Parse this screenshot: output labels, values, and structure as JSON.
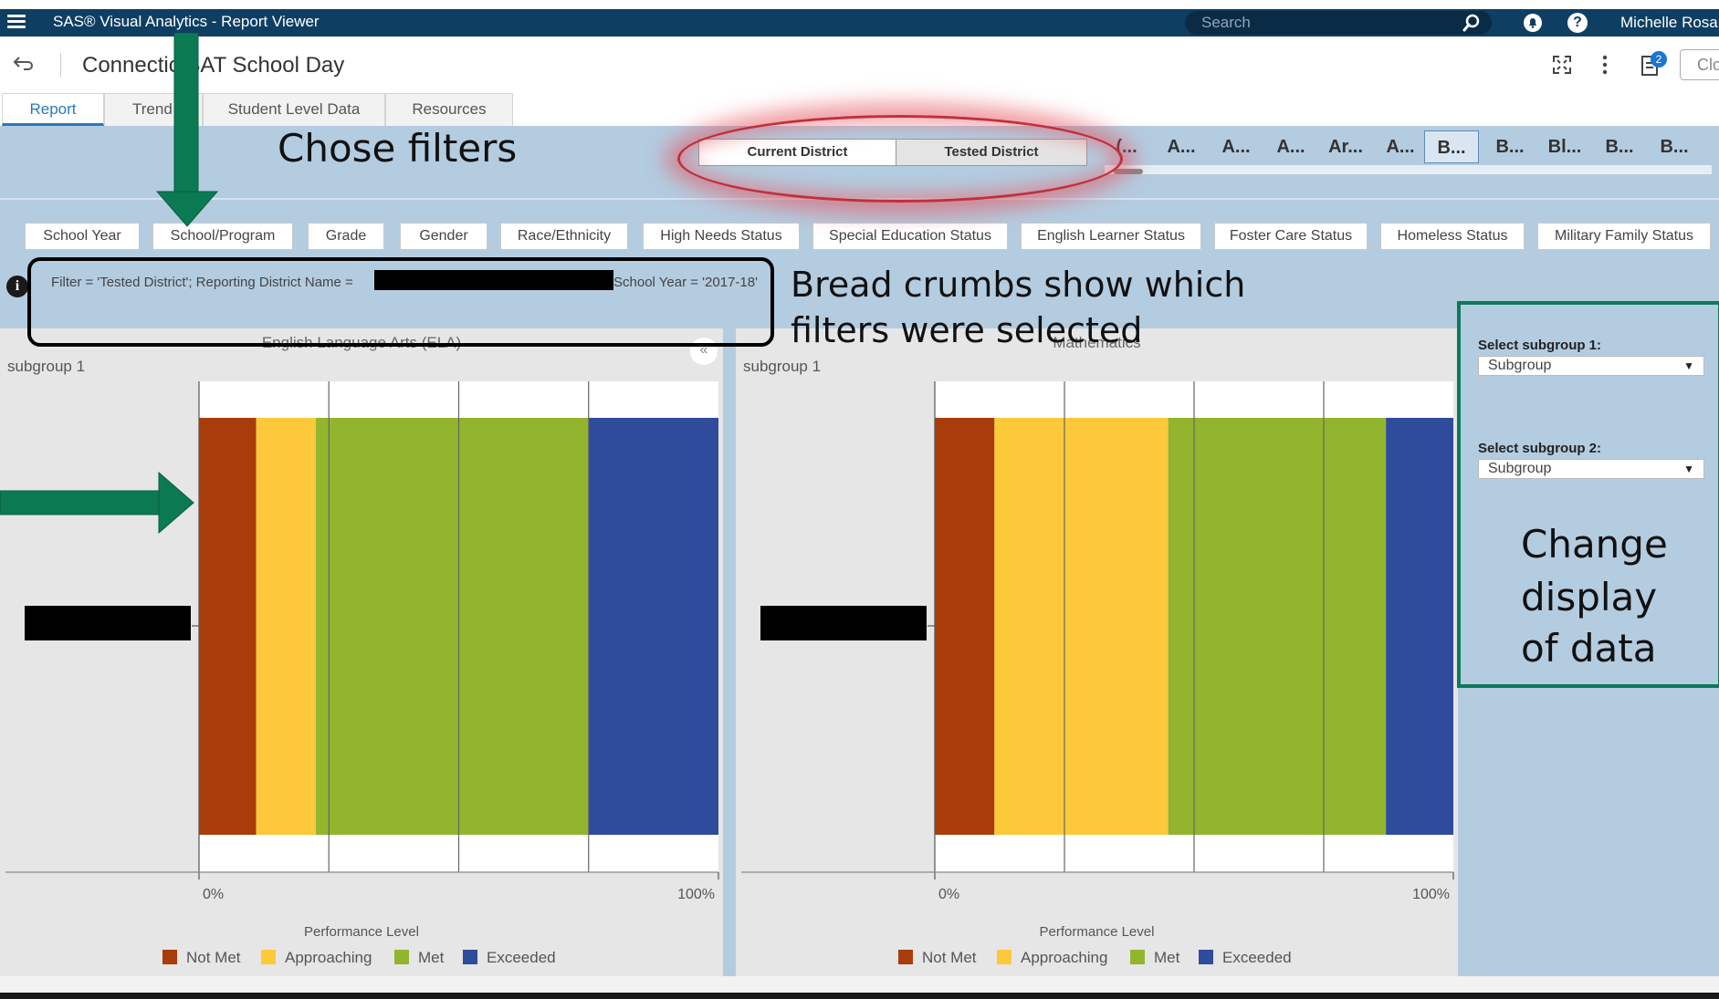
{
  "app": {
    "title": "SAS® Visual Analytics - Report Viewer",
    "search_placeholder": "Search",
    "user_name": "Michelle Rosa"
  },
  "report": {
    "title": "Connectic  SAT School Day",
    "close_label": "Clo",
    "notes_count": "2"
  },
  "tabs": [
    {
      "label": "Report",
      "active": true
    },
    {
      "label": "Trend",
      "active": false
    },
    {
      "label": "Student Level Data",
      "active": false
    },
    {
      "label": "Resources",
      "active": false
    }
  ],
  "district_toggle": {
    "current": "Current District",
    "tested": "Tested District",
    "selected": "Tested District"
  },
  "district_buttons": [
    "(...",
    "A...",
    "A...",
    "A...",
    "Ar...",
    "A...",
    "B...",
    "B...",
    "Bl...",
    "B...",
    "B..."
  ],
  "district_selected_index": 6,
  "filters": [
    "School Year",
    "School/Program",
    "Grade",
    "Gender",
    "Race/Ethnicity",
    "High Needs Status",
    "Special Education Status",
    "English Learner Status",
    "Foster Care Status",
    "Homeless Status",
    "Military Family Status"
  ],
  "breadcrumb": {
    "text": "Filter = 'Tested District'; Reporting District Name =",
    "year": "School Year = '2017-18'"
  },
  "panels": [
    {
      "title": "English Language Arts (ELA)",
      "subgroup": "subgroup 1"
    },
    {
      "title": "Mathematics",
      "subgroup": "subgroup 1"
    }
  ],
  "side_panel": {
    "label1": "Select subgroup 1:",
    "value1": "Subgroup",
    "label2": "Select subgroup 2:",
    "value2": "Subgroup"
  },
  "annotations": {
    "chose_filters": "Chose filters",
    "breadcrumbs_line1": "Bread crumbs show which",
    "breadcrumbs_line2": "filters were selected",
    "change_line1": "Change",
    "change_line2": "display",
    "change_line3": "of data"
  },
  "colors": {
    "not_met": "#a83c0a",
    "approaching": "#fcc93a",
    "met": "#92b52d",
    "exceeded": "#2e4b9c",
    "nav": "#0f3e63",
    "panel_bg": "#b4cce0"
  },
  "chart_data": [
    {
      "type": "bar",
      "orientation": "horizontal-stacked-100",
      "title": "English Language Arts (ELA)",
      "xlabel": "Performance Level",
      "x_ticks": [
        "0%",
        "100%"
      ],
      "xlim": [
        0,
        100
      ],
      "legend_placement": "bottom",
      "grid": true,
      "series": [
        {
          "name": "Not Met",
          "values": [
            11
          ]
        },
        {
          "name": "Approaching",
          "values": [
            11.5
          ]
        },
        {
          "name": "Met",
          "values": [
            52.5
          ]
        },
        {
          "name": "Exceeded",
          "values": [
            25
          ]
        }
      ]
    },
    {
      "type": "bar",
      "orientation": "horizontal-stacked-100",
      "title": "Mathematics",
      "xlabel": "Performance Level",
      "x_ticks": [
        "0%",
        "100%"
      ],
      "xlim": [
        0,
        100
      ],
      "legend_placement": "bottom",
      "grid": true,
      "series": [
        {
          "name": "Not Met",
          "values": [
            11.5
          ]
        },
        {
          "name": "Approaching",
          "values": [
            33.5
          ]
        },
        {
          "name": "Met",
          "values": [
            42
          ]
        },
        {
          "name": "Exceeded",
          "values": [
            13
          ]
        }
      ]
    }
  ]
}
